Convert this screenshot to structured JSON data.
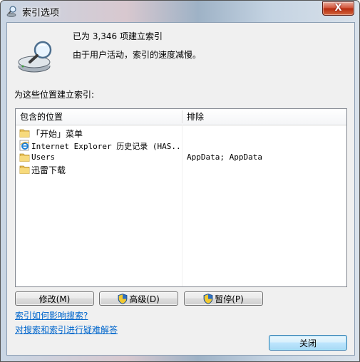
{
  "window": {
    "title": "索引选项",
    "close_glyph": "X"
  },
  "status": {
    "count_text": "已为 3,346 项建立索引",
    "message": "由于用户活动，索引的速度减慢。"
  },
  "locations_label": "为这些位置建立索引:",
  "table": {
    "columns": [
      "包含的位置",
      "排除"
    ],
    "rows": [
      {
        "icon": "folder-icon",
        "name": "「开始」菜单",
        "excluded": ""
      },
      {
        "icon": "internet-explorer-icon",
        "name": "Internet Explorer 历史记录 (HAS...",
        "excluded": ""
      },
      {
        "icon": "folder-icon",
        "name": "Users",
        "excluded": "AppData; AppData"
      },
      {
        "icon": "folder-icon",
        "name": "迅雷下载",
        "excluded": ""
      }
    ]
  },
  "buttons": {
    "modify": "修改(M)",
    "advanced": "高级(D)",
    "pause": "暂停(P)",
    "close": "关闭"
  },
  "links": {
    "how_affects_search": "索引如何影响搜索?",
    "troubleshoot": "对搜索和索引进行疑难解答"
  }
}
